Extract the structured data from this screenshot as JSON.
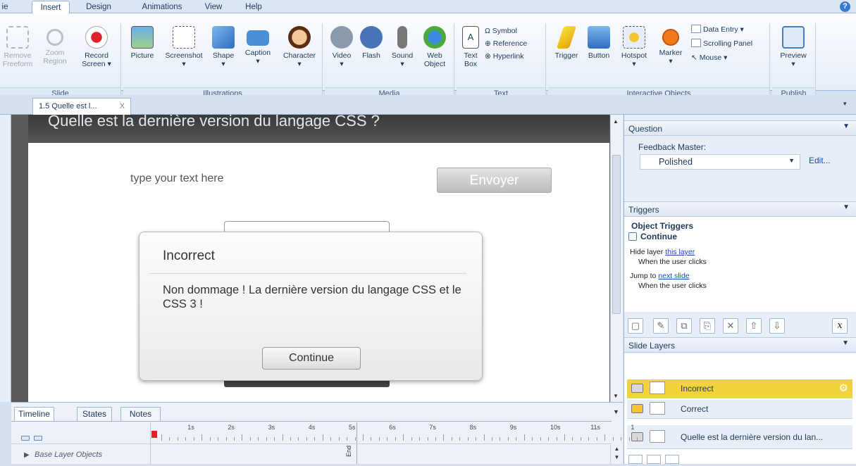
{
  "ribbon_tabs": [
    "ie",
    "Insert",
    "Design",
    "Animations",
    "View",
    "Help"
  ],
  "help_label": "?",
  "groups": {
    "slide": {
      "label": "Slide",
      "buttons": [
        [
          "Remove",
          "Freeform"
        ],
        [
          "Zoom",
          "Region"
        ],
        [
          "Record",
          "Screen ▾"
        ]
      ]
    },
    "illustrations": {
      "label": "Illustrations",
      "buttons": [
        [
          "Picture"
        ],
        [
          "Screenshot",
          "▾"
        ],
        [
          "Shape",
          "▾"
        ],
        [
          "Caption",
          "▾"
        ],
        [
          "Character",
          "▾"
        ]
      ]
    },
    "media": {
      "label": "Media",
      "buttons": [
        [
          "Video",
          "▾"
        ],
        [
          "Flash"
        ],
        [
          "Sound",
          "▾"
        ],
        [
          "Web",
          "Object"
        ]
      ]
    },
    "text": {
      "label": "Text",
      "buttons": [
        [
          "Text",
          "Box"
        ]
      ],
      "small": [
        "Symbol",
        "Reference",
        "Hyperlink"
      ]
    },
    "interactive": {
      "label": "Interactive Objects",
      "buttons": [
        [
          "Trigger"
        ],
        [
          "Button"
        ],
        [
          "Hotspot",
          "▾"
        ],
        [
          "Marker",
          "▾"
        ]
      ],
      "small": [
        "Data Entry ▾",
        "Scrolling Panel",
        "Mouse ▾"
      ]
    },
    "publish": {
      "label": "Publish",
      "buttons": [
        [
          "Preview",
          "▾"
        ]
      ]
    }
  },
  "doc_tab": {
    "label": "1.5 Quelle est l...",
    "close": "X"
  },
  "slide": {
    "title": "Quelle est la dernière version du langage CSS ?",
    "input_placeholder": "type your text here",
    "submit": "Envoyer"
  },
  "dialog": {
    "title": "Incorrect",
    "message": "Non dommage ! La dernière version du langage CSS et le CSS 3 !",
    "button": "Continue"
  },
  "panel": {
    "question": {
      "title": "Question",
      "feedback_label": "Feedback Master:",
      "feedback_value": "Polished",
      "edit": "Edit..."
    },
    "triggers": {
      "title": "Triggers",
      "object_triggers": "Object Triggers",
      "continue_label": "Continue",
      "t1_action": "Hide layer",
      "t1_link": "this layer",
      "t1_when": "When the user clicks",
      "t2_action": "Jump to",
      "t2_link": "next slide",
      "t2_when": "When the user clicks"
    },
    "toolbar_x": "x",
    "layers": {
      "title": "Slide Layers",
      "items": [
        {
          "name": "Incorrect"
        },
        {
          "name": "Correct"
        },
        {
          "name": "Quelle est la dernière version du lan..."
        }
      ]
    }
  },
  "timeline": {
    "tabs": [
      "Timeline",
      "States",
      "Notes"
    ],
    "ticks": [
      "1s",
      "2s",
      "3s",
      "4s",
      "5s",
      "6s",
      "7s",
      "8s",
      "9s",
      "10s",
      "11s",
      "1"
    ],
    "end_label": "End",
    "base_layer": "Base Layer Objects"
  },
  "colors": {
    "selected_layer": "#f3d33c",
    "ribbon_accent": "#dbe6f4"
  }
}
